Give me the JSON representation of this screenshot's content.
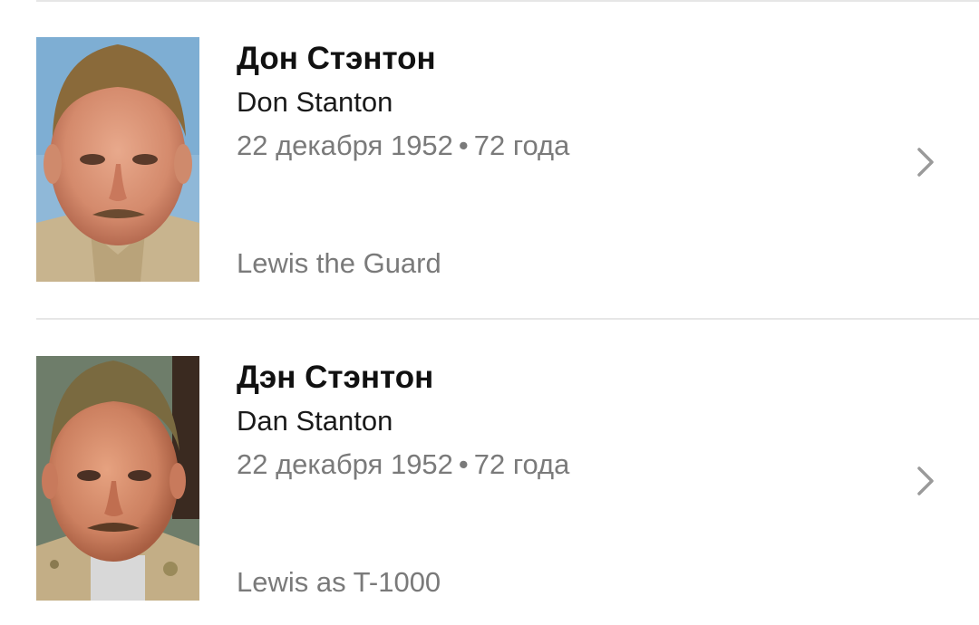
{
  "people": [
    {
      "name_ru": "Дон Стэнтон",
      "name_en": "Don Stanton",
      "birth_date": "22 декабря 1952",
      "separator": "•",
      "age": "72 года",
      "role": "Lewis the Guard",
      "photo_icon": "person-photo",
      "chevron_icon": "chevron-right-icon"
    },
    {
      "name_ru": "Дэн Стэнтон",
      "name_en": "Dan Stanton",
      "birth_date": "22 декабря 1952",
      "separator": "•",
      "age": "72 года",
      "role": "Lewis as T-1000",
      "photo_icon": "person-photo",
      "chevron_icon": "chevron-right-icon"
    }
  ],
  "colors": {
    "primary_text": "#111111",
    "secondary_text": "#7a7a7a",
    "divider": "#e6e6e6",
    "chevron": "#9a9a9a"
  }
}
